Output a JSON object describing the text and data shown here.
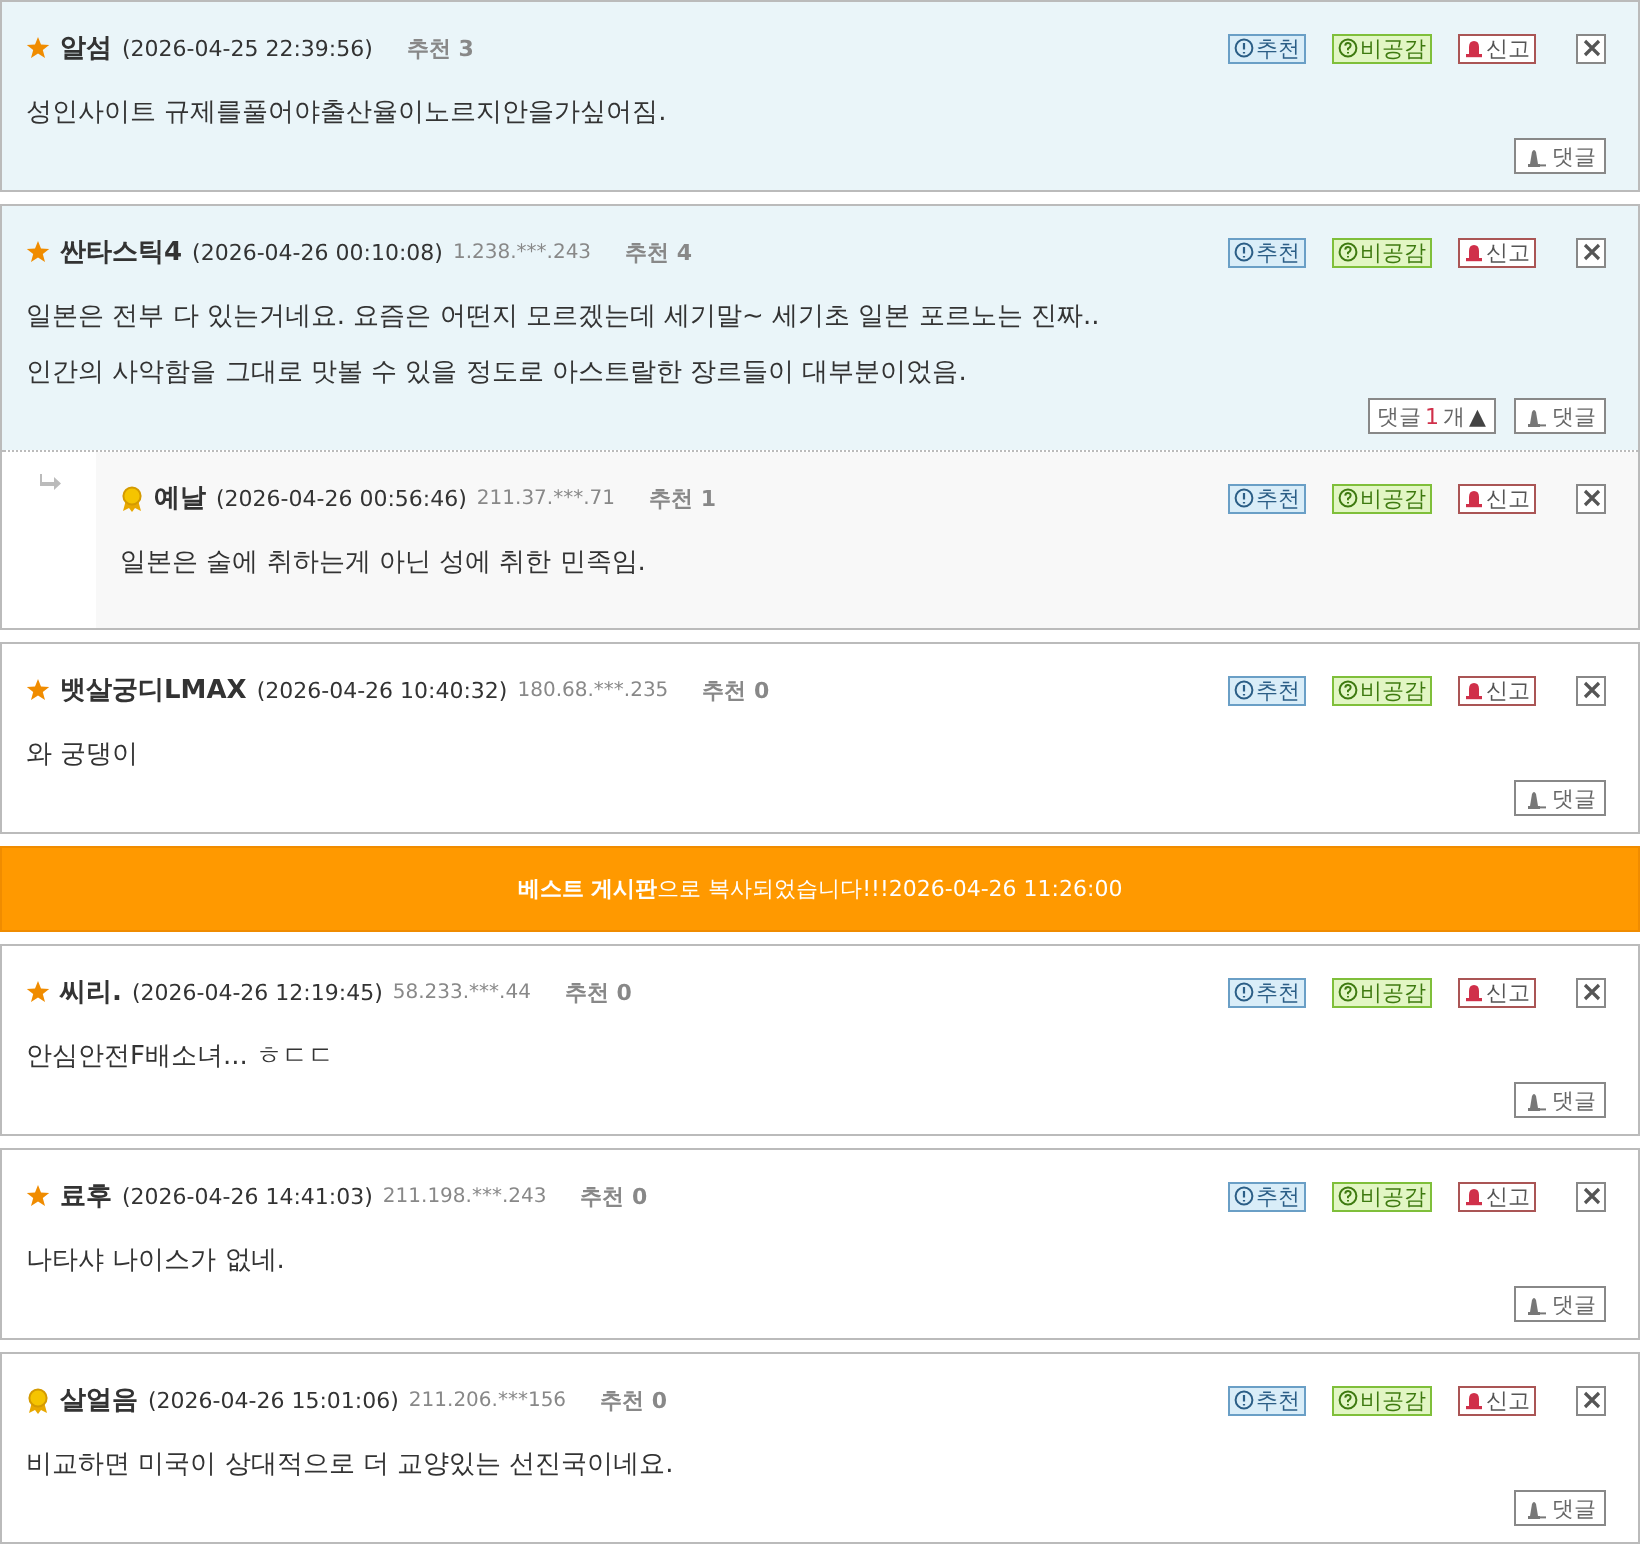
{
  "comments": [
    {
      "kind": "comment",
      "highlighted": true,
      "badge": {
        "kind": "star"
      },
      "nickname": "알섬",
      "date": "(2026-04-25 22:39:56)",
      "recommend_label": "추천",
      "recommend_count": "3",
      "body": [
        "성인사이트 규제를풀어야출산율이노르지안을가싶어짐."
      ],
      "actions": [
        {
          "kind": "recommend",
          "label": "추천"
        },
        {
          "kind": "dislike",
          "label": "비공감"
        },
        {
          "kind": "report",
          "label": "신고"
        },
        {
          "kind": "close"
        }
      ],
      "reply_button": "댓글"
    },
    {
      "kind": "comment",
      "highlighted": true,
      "badge": {
        "kind": "star"
      },
      "nickname": "싼타스틱4",
      "date": "(2026-04-26 00:10:08)",
      "ip": "1.238.***.243",
      "recommend_label": "추천",
      "recommend_count": "4",
      "body": [
        "일본은 전부 다 있는거네요. 요즘은 어떤지 모르겠는데 세기말~ 세기초 일본 포르노는 진짜..",
        "인간의 사악함을 그대로 맛볼 수 있을 정도로 아스트랄한 장르들이 대부분이었음."
      ],
      "actions": [
        {
          "kind": "recommend",
          "label": "추천"
        },
        {
          "kind": "dislike",
          "label": "비공감"
        },
        {
          "kind": "report",
          "label": "신고"
        },
        {
          "kind": "close"
        }
      ],
      "reply_toggle": {
        "label": "댓글",
        "count": "1",
        "unit": "개",
        "arrow": "▲",
        "expanded": true
      },
      "reply_button": "댓글",
      "replies": [
        {
          "badge": {
            "kind": "medal"
          },
          "nickname": "예날",
          "date": "(2026-04-26 00:56:46)",
          "ip": "211.37.***.71",
          "recommend_label": "추천",
          "recommend_count": "1",
          "body": [
            "일본은 술에 취하는게 아닌 성에 취한 민족임."
          ],
          "actions": [
            {
              "kind": "recommend",
              "label": "추천"
            },
            {
              "kind": "dislike",
              "label": "비공감"
            },
            {
              "kind": "report",
              "label": "신고"
            },
            {
              "kind": "close"
            }
          ]
        }
      ]
    },
    {
      "kind": "comment",
      "highlighted": false,
      "badge": {
        "kind": "star"
      },
      "nickname": "뱃살궁디LMAX",
      "date": "(2026-04-26 10:40:32)",
      "ip": "180.68.***.235",
      "recommend_label": "추천",
      "recommend_count": "0",
      "body": [
        "와 궁댕이"
      ],
      "actions": [
        {
          "kind": "recommend",
          "label": "추천"
        },
        {
          "kind": "dislike",
          "label": "비공감"
        },
        {
          "kind": "report",
          "label": "신고"
        },
        {
          "kind": "close"
        }
      ],
      "reply_button": "댓글"
    },
    {
      "kind": "banner",
      "text": "**베스트 게시판**으로 복사되었습니다!!!2026-04-26 11:26:00"
    },
    {
      "kind": "comment",
      "highlighted": false,
      "badge": {
        "kind": "star"
      },
      "nickname": "씨리.",
      "date": "(2026-04-26 12:19:45)",
      "ip": "58.233.***.44",
      "recommend_label": "추천",
      "recommend_count": "0",
      "body": [
        "안심안전F배소녀...  ㅎㄷㄷ"
      ],
      "actions": [
        {
          "kind": "recommend",
          "label": "추천"
        },
        {
          "kind": "dislike",
          "label": "비공감"
        },
        {
          "kind": "report",
          "label": "신고"
        },
        {
          "kind": "close"
        }
      ],
      "reply_button": "댓글"
    },
    {
      "kind": "comment",
      "highlighted": false,
      "badge": {
        "kind": "star"
      },
      "nickname": "료후",
      "date": "(2026-04-26 14:41:03)",
      "ip": "211.198.***.243",
      "recommend_label": "추천",
      "recommend_count": "0",
      "body": [
        "나타샤 나이스가 없네."
      ],
      "actions": [
        {
          "kind": "recommend",
          "label": "추천"
        },
        {
          "kind": "dislike",
          "label": "비공감"
        },
        {
          "kind": "report",
          "label": "신고"
        },
        {
          "kind": "close"
        }
      ],
      "reply_button": "댓글"
    },
    {
      "kind": "comment",
      "highlighted": false,
      "badge": {
        "kind": "medal"
      },
      "nickname": "살얼음",
      "date": "(2026-04-26 15:01:06)",
      "ip": "211.206.***156",
      "recommend_label": "추천",
      "recommend_count": "0",
      "body": [
        "비교하면 미국이 상대적으로 더 교양있는 선진국이네요."
      ],
      "actions": [
        {
          "kind": "recommend",
          "label": "추천"
        },
        {
          "kind": "dislike",
          "label": "비공감"
        },
        {
          "kind": "report",
          "label": "신고"
        },
        {
          "kind": "close"
        }
      ],
      "reply_button": "댓글"
    }
  ]
}
